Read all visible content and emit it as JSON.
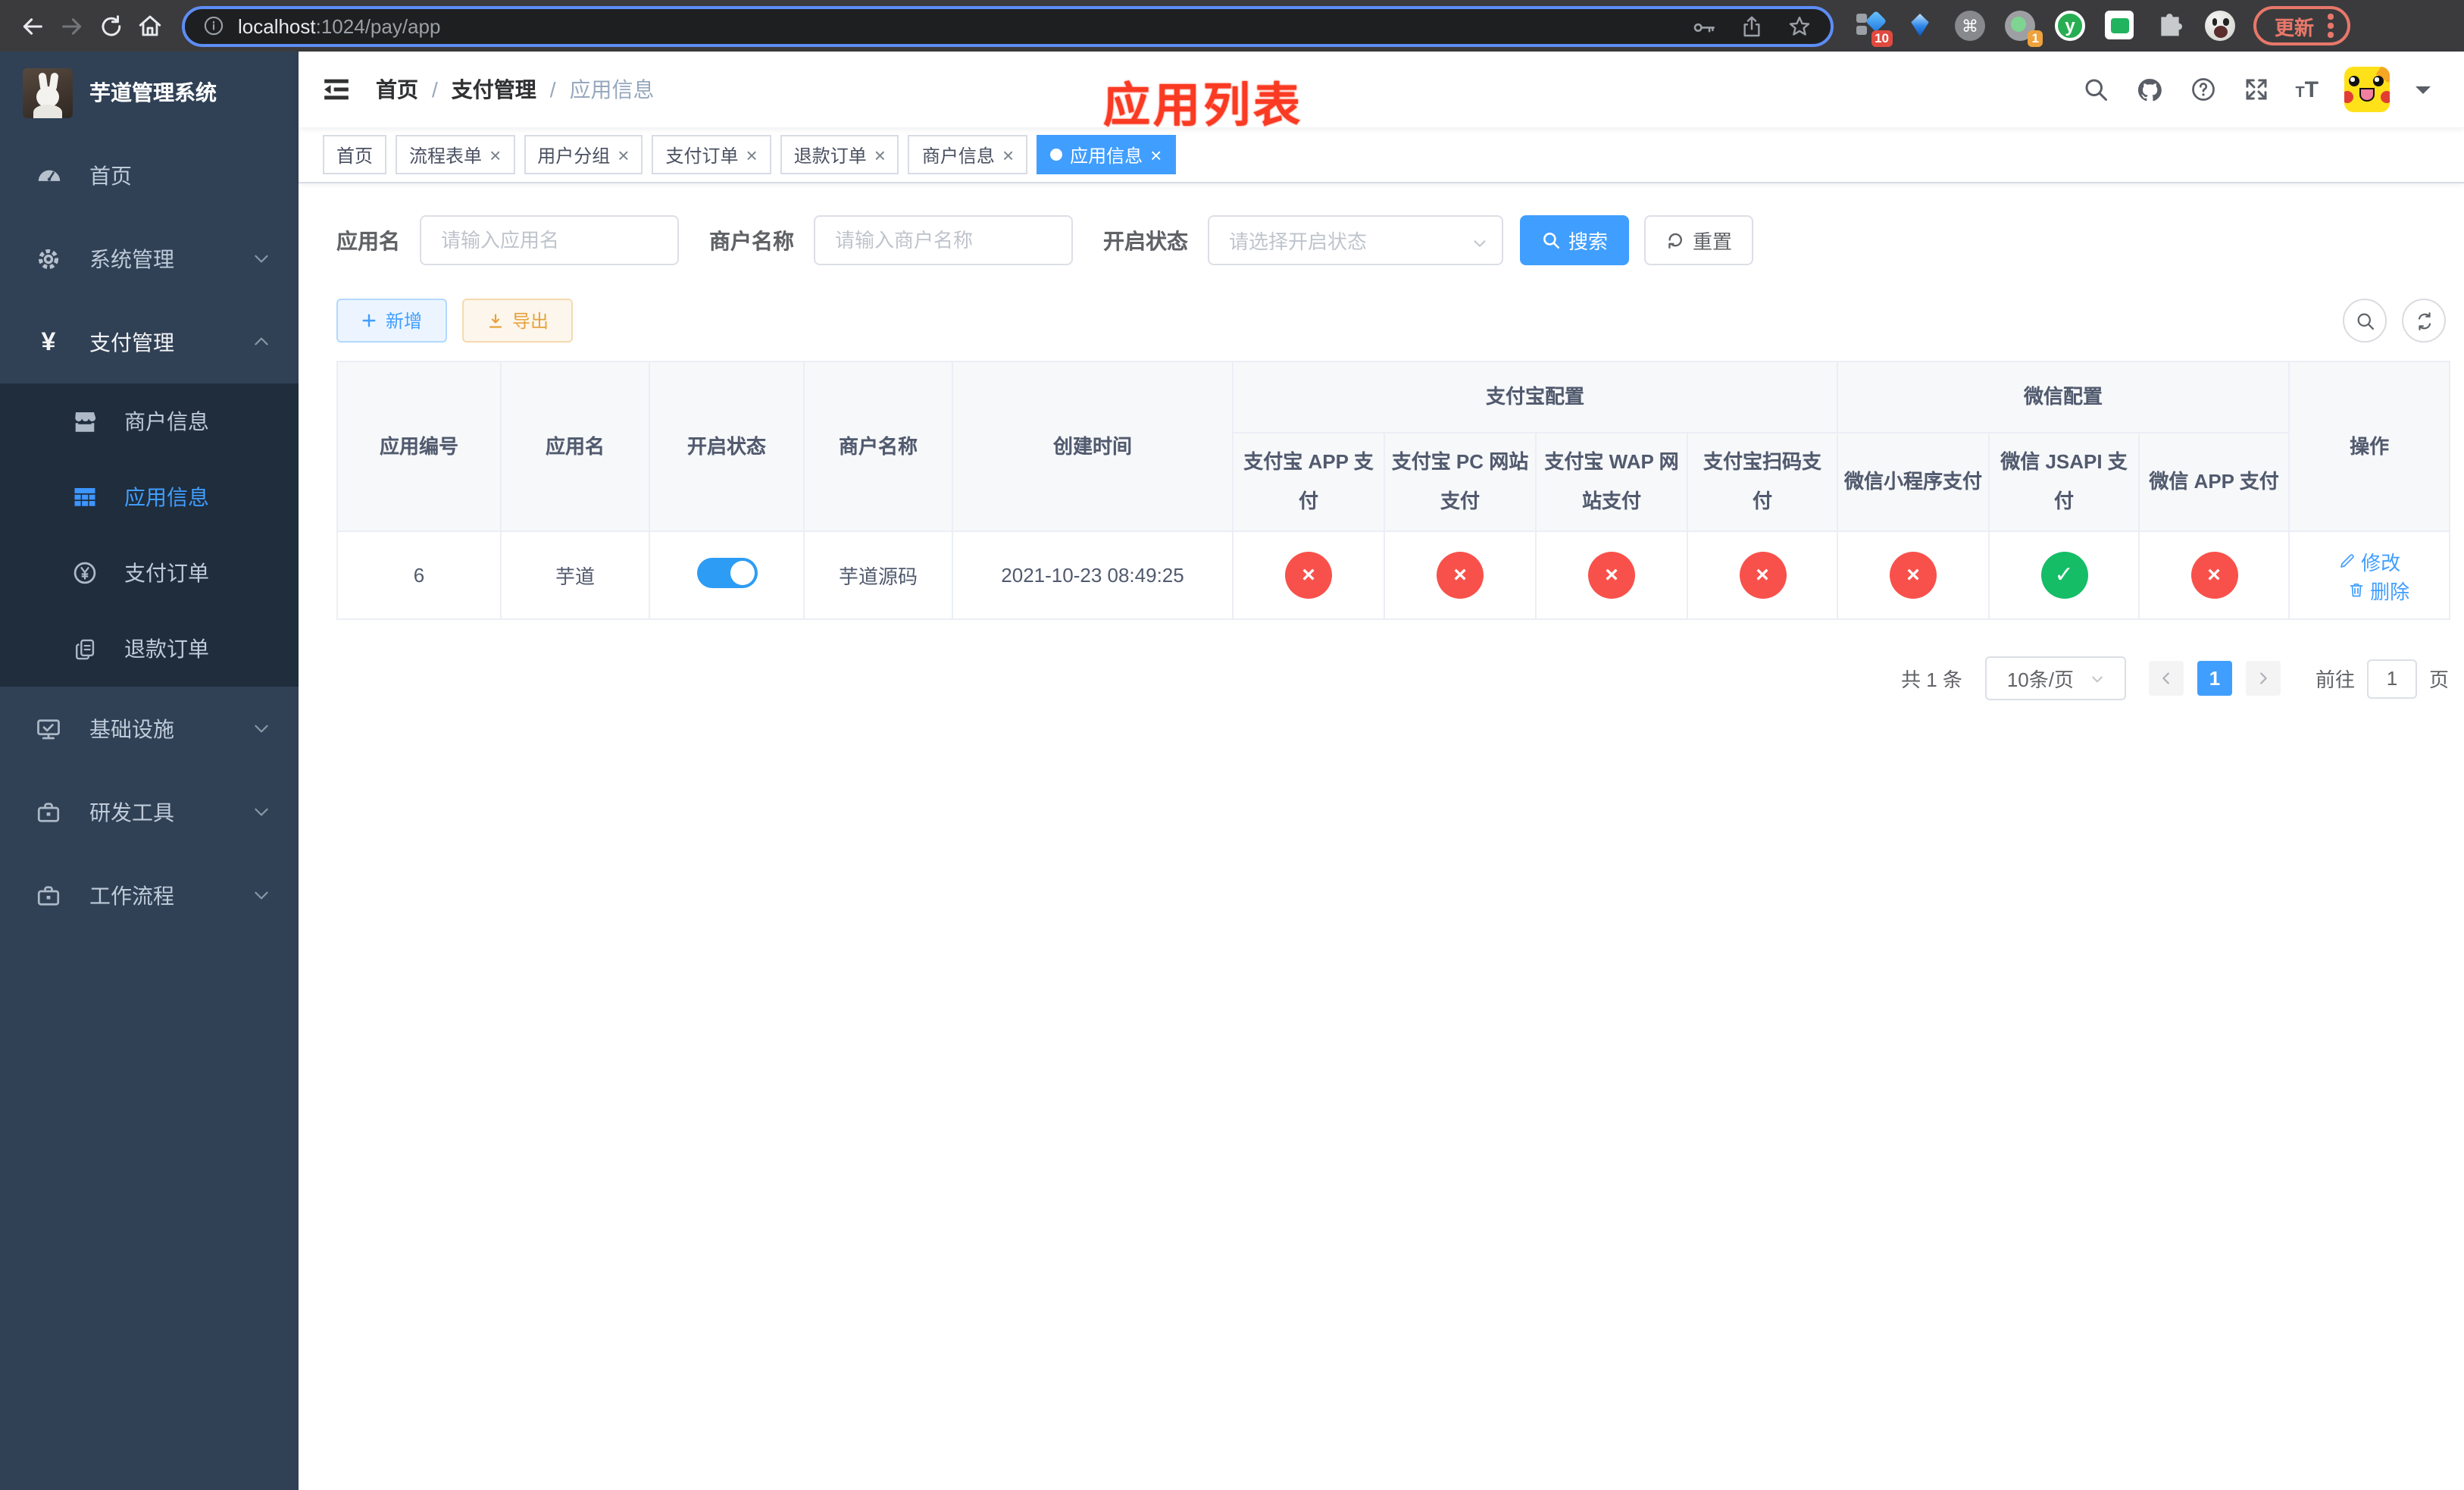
{
  "browser": {
    "url_host": "localhost",
    "url_rest": ":1024/pay/app",
    "update_label": "更新",
    "ext_badge_devtools": "10",
    "ext_badge_proxy": "1",
    "ext_yuque_letter": "y"
  },
  "glyphs": {
    "yen": "¥",
    "command": "⌘",
    "close": "×",
    "crumb_sep": "/",
    "status_on": "✓",
    "status_off": "×",
    "font_small": "T",
    "font_big": "T"
  },
  "colors": {
    "accent": "#409EFF",
    "danger": "#f8514b",
    "success": "#15bd66",
    "warning": "#e6a23c",
    "annotation": "#fa3a22",
    "sidebar_bg": "#304156",
    "submenu_bg": "#1f2d3d"
  },
  "sidebar": {
    "title": "芋道管理系统",
    "items": [
      {
        "label": "首页"
      },
      {
        "label": "系统管理"
      },
      {
        "label": "支付管理"
      },
      {
        "label": "商户信息"
      },
      {
        "label": "应用信息"
      },
      {
        "label": "支付订单"
      },
      {
        "label": "退款订单"
      },
      {
        "label": "基础设施"
      },
      {
        "label": "研发工具"
      },
      {
        "label": "工作流程"
      }
    ]
  },
  "header": {
    "breadcrumb": [
      "首页",
      "支付管理",
      "应用信息"
    ],
    "annotation": "应用列表"
  },
  "tabs": [
    {
      "label": "首页"
    },
    {
      "label": "流程表单"
    },
    {
      "label": "用户分组"
    },
    {
      "label": "支付订单"
    },
    {
      "label": "退款订单"
    },
    {
      "label": "商户信息"
    },
    {
      "label": "应用信息"
    }
  ],
  "filters": {
    "app_name_label": "应用名",
    "app_name_placeholder": "请输入应用名",
    "merchant_label": "商户名称",
    "merchant_placeholder": "请输入商户名称",
    "status_label": "开启状态",
    "status_placeholder": "请选择开启状态",
    "search_label": "搜索",
    "reset_label": "重置"
  },
  "toolbar": {
    "add_label": "新增",
    "export_label": "导出"
  },
  "table": {
    "group_alipay": "支付宝配置",
    "group_wechat": "微信配置",
    "columns": [
      "应用编号",
      "应用名",
      "开启状态",
      "商户名称",
      "创建时间",
      "支付宝 APP 支付",
      "支付宝 PC 网站支付",
      "支付宝 WAP 网站支付",
      "支付宝扫码支付",
      "微信小程序支付",
      "微信 JSAPI 支付",
      "微信 APP 支付",
      "操作"
    ],
    "row": {
      "id": "6",
      "name": "芋道",
      "enabled": true,
      "merchant": "芋道源码",
      "created_at": "2021-10-23 08:49:25",
      "statuses": [
        "off",
        "off",
        "off",
        "off",
        "off",
        "on",
        "off"
      ],
      "edit_label": "修改",
      "delete_label": "删除"
    }
  },
  "pagination": {
    "total": "共 1 条",
    "page_size": "10条/页",
    "current_page": "1",
    "goto_label": "前往",
    "goto_value": "1",
    "page_unit": "页"
  }
}
